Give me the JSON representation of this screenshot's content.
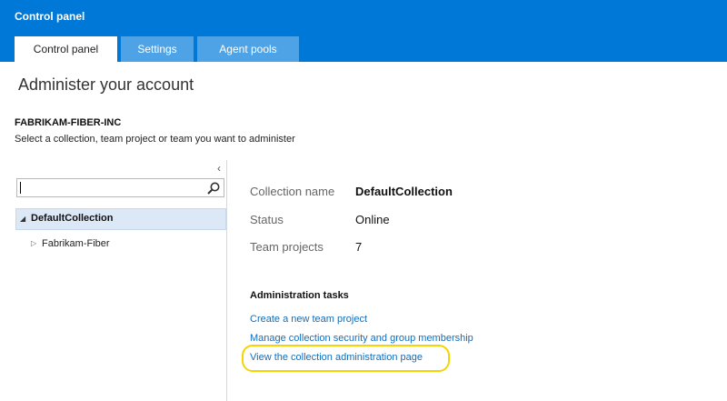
{
  "app": {
    "title": "Control panel"
  },
  "tabs": [
    {
      "label": "Control panel",
      "active": true
    },
    {
      "label": "Settings",
      "active": false
    },
    {
      "label": "Agent pools",
      "active": false
    }
  ],
  "page": {
    "heading": "Administer your account",
    "account_name": "FABRIKAM-FIBER-INC",
    "instructions": "Select a collection, team project or team you want to administer"
  },
  "left_panel": {
    "collapse_icon": "chevron-left-icon",
    "search": {
      "value": "",
      "placeholder": "",
      "icon": "search-icon"
    },
    "tree": [
      {
        "label": "DefaultCollection",
        "expanded": true,
        "selected": true
      },
      {
        "label": "Fabrikam-Fiber",
        "expanded": false,
        "selected": false
      }
    ]
  },
  "details": {
    "rows": [
      {
        "label": "Collection name",
        "value": "DefaultCollection"
      },
      {
        "label": "Status",
        "value": "Online"
      },
      {
        "label": "Team projects",
        "value": "7"
      }
    ]
  },
  "admin_tasks": {
    "heading": "Administration tasks",
    "links": [
      "Create a new team project",
      "Manage collection security and group membership",
      "View the collection administration page"
    ]
  },
  "colors": {
    "header_bg": "#0078d7",
    "inactive_tab": "#4ea3e6",
    "link": "#106ebe",
    "selection": "#dde8f6",
    "highlight": "#f5d400"
  }
}
